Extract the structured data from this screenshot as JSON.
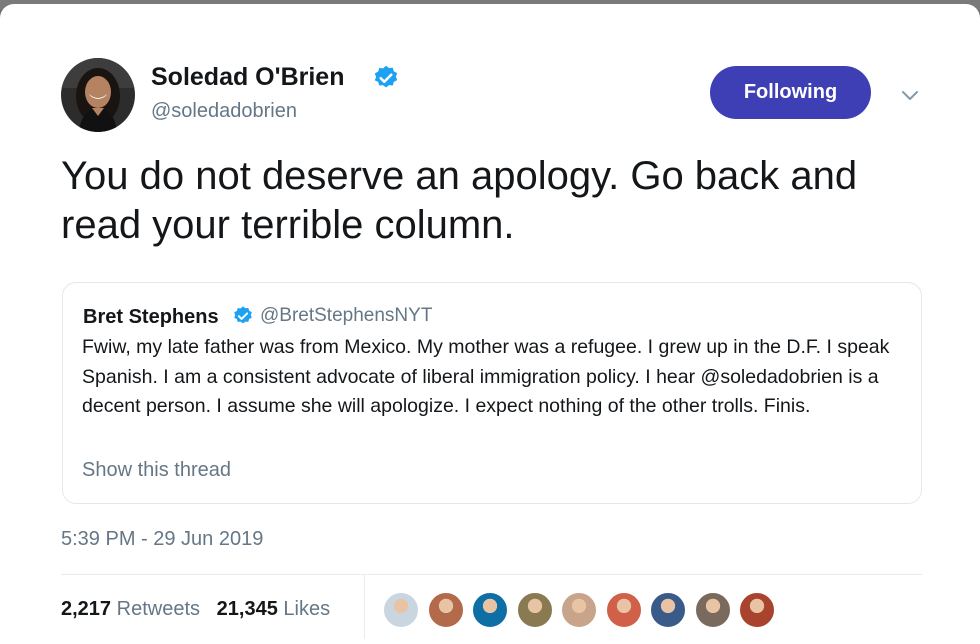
{
  "tweet": {
    "author_name": "Soledad O'Brien",
    "author_handle": "@soledadobrien",
    "follow_label": "Following",
    "text": "You do not deserve an apology. Go back and read your terrible column.",
    "timestamp": "5:39 PM - 29 Jun 2019",
    "verified_color": "#1da1f2",
    "follow_color": "#3f3fb5"
  },
  "quoted": {
    "author_name": "Bret Stephens",
    "author_handle": "@BretStephensNYT",
    "text": "Fwiw, my late father was from Mexico. My mother was a refugee. I grew up in the D.F. I speak Spanish. I am a consistent advocate of liberal immigration policy. I hear @soledadobrien is a decent person. I assume she will apologize. I expect nothing of the other trolls. Finis.",
    "thread_link": "Show this thread"
  },
  "stats": {
    "retweets_count": "2,217",
    "retweets_label": "Retweets",
    "likes_count": "21,345",
    "likes_label": "Likes"
  },
  "likers": [
    {
      "icon": "liker-avatar-1",
      "color": "#c9d6e0"
    },
    {
      "icon": "liker-avatar-2",
      "color": "#b36a4a"
    },
    {
      "icon": "liker-avatar-3",
      "color": "#0d6fa6"
    },
    {
      "icon": "liker-avatar-4",
      "color": "#8a7a52"
    },
    {
      "icon": "liker-avatar-5",
      "color": "#c8a48a"
    },
    {
      "icon": "liker-avatar-6",
      "color": "#d0604a"
    },
    {
      "icon": "liker-avatar-7",
      "color": "#3a5a8a"
    },
    {
      "icon": "liker-avatar-8",
      "color": "#7a6a5e"
    },
    {
      "icon": "liker-avatar-9",
      "color": "#a8442e"
    }
  ]
}
